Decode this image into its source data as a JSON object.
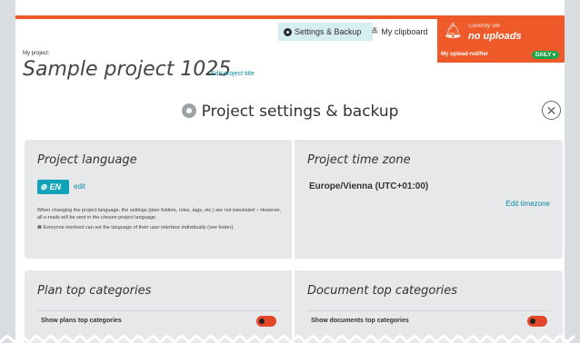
{
  "header": {
    "tabs": [
      {
        "label": "Settings & Backup",
        "icon": "gear-icon",
        "active": true
      },
      {
        "label": "My clipboard",
        "icon": "clipboard-icon",
        "active": false
      }
    ],
    "notifier": {
      "status_small": "Currently still",
      "status": "no uploads",
      "label": "My upload-notifier",
      "frequency": "DAILY ▾",
      "icon": "bell-icon"
    }
  },
  "project": {
    "label": "My project:",
    "title": "Sample project 1025",
    "edit_label": "Edit project title"
  },
  "settings": {
    "heading": "Project settings & backup",
    "close_symbol": "✕"
  },
  "language": {
    "title": "Project language",
    "code": "EN",
    "edit_label": "edit",
    "note1": "When changing the project language, the settings (plan folders, roles, tags, etc.) are not translated – However, all e-mails will be sent in the chosen project language.",
    "note2": "❷ Everyone involved can set the language of their user interface individually (see footer)."
  },
  "timezone": {
    "title": "Project time zone",
    "value": "Europe/Vienna (UTC+01:00)",
    "edit_label": "Edit timezone"
  },
  "plans": {
    "title": "Plan top categories",
    "toggle_label": "Show plans top categories",
    "enabled": false
  },
  "documents": {
    "title": "Document top categories",
    "toggle_label": "Show documents top categories",
    "enabled": false
  },
  "colors": {
    "accent": "#ef5a2b",
    "link": "#0a8aa8",
    "badge": "#11a3b8",
    "daily": "#1fa34a",
    "toggle_off": "#e2472a"
  }
}
